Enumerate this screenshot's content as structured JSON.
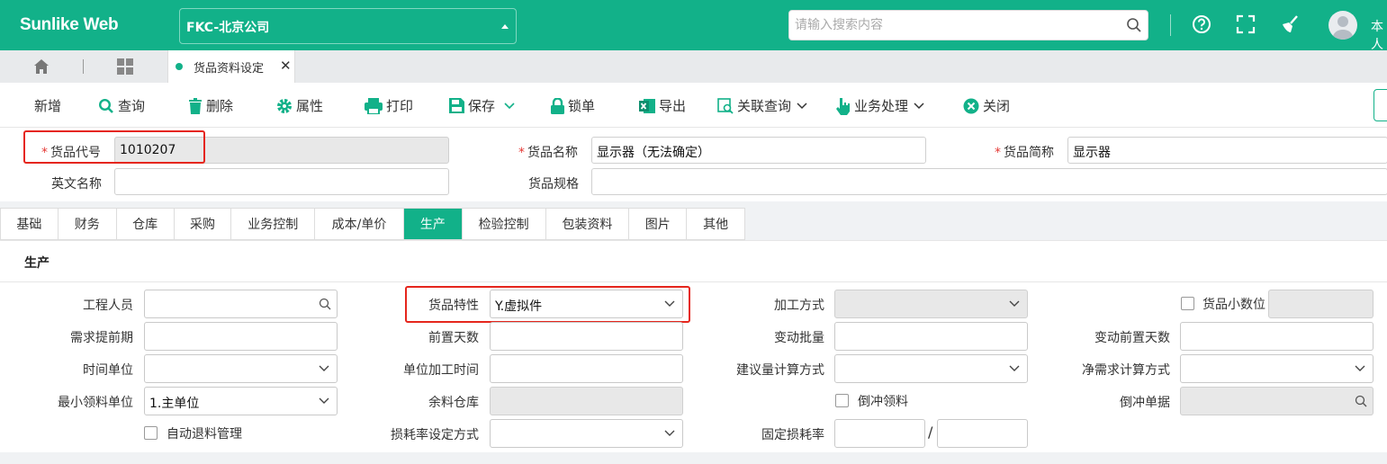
{
  "app": {
    "logo": "Sunlike Web",
    "company": "FKC-北京公司",
    "search_placeholder": "请输入搜索内容",
    "user": "本人",
    "accent": "#12b189"
  },
  "tabbar": {
    "doc_tab": "货品资料设定",
    "close": "✕"
  },
  "toolbar": {
    "new": "新增",
    "query": "查询",
    "delete": "删除",
    "properties": "属性",
    "print": "打印",
    "save": "保存",
    "lock": "锁单",
    "export": "导出",
    "related_query": "关联查询",
    "business": "业务处理",
    "close": "关闭"
  },
  "header": {
    "item_code_label": "货品代号",
    "item_code": "1010207",
    "item_name_label": "货品名称",
    "item_name": "显示器（无法确定）",
    "item_short_label": "货品简称",
    "item_short": "显示器",
    "english_name_label": "英文名称",
    "english_name": "",
    "spec_label": "货品规格",
    "spec": ""
  },
  "tabs": [
    "基础",
    "财务",
    "仓库",
    "采购",
    "业务控制",
    "成本/单价",
    "生产",
    "检验控制",
    "包装资料",
    "图片",
    "其他"
  ],
  "active_tab": "生产",
  "section": {
    "title": "生产",
    "engineer_label": "工程人员",
    "engineer": "",
    "item_property_label": "货品特性",
    "item_property": "Y.虚拟件",
    "process_method_label": "加工方式",
    "process_method": "",
    "decimal_label": "货品小数位",
    "decimal": "",
    "lead_days_label": "需求提前期",
    "lead_days": "",
    "pre_days_label": "前置天数",
    "pre_days": "",
    "change_batch_label": "变动批量",
    "change_batch": "",
    "change_pre_days_label": "变动前置天数",
    "change_pre_days": "",
    "time_unit_label": "时间单位",
    "time_unit": "",
    "unit_proc_time_label": "单位加工时间",
    "unit_proc_time": "",
    "suggest_calc_label": "建议量计算方式",
    "suggest_calc": "",
    "net_req_calc_label": "净需求计算方式",
    "net_req_calc": "",
    "min_issue_unit_label": "最小领料单位",
    "min_issue_unit": "1.主单位",
    "surplus_wh_label": "余料仓库",
    "surplus_wh": "",
    "backflush_label": "倒冲领料",
    "backflush_doc_label": "倒冲单据",
    "backflush_doc": "",
    "auto_return_label": "自动退料管理",
    "loss_rate_method_label": "损耗率设定方式",
    "loss_rate_method": "",
    "fixed_loss_label": "固定损耗率",
    "fixed_loss_a": "",
    "fixed_loss_sep": "/",
    "fixed_loss_b": ""
  }
}
